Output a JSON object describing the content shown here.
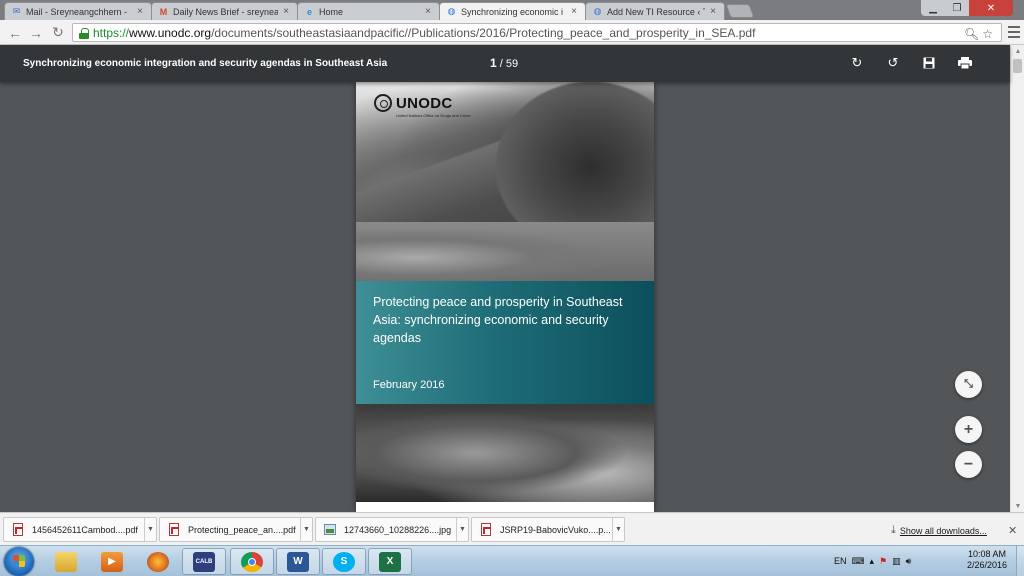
{
  "browser": {
    "tabs": [
      {
        "label": "Mail - Sreyneangchhern -",
        "icon": "mail-icon",
        "color": "#3a78c8"
      },
      {
        "label": "Daily News Brief - sreynea",
        "icon": "gmail-icon",
        "color": "#d44638"
      },
      {
        "label": "Home",
        "icon": "ie-icon",
        "color": "#2a8ee0"
      },
      {
        "label": "Synchronizing economic i",
        "icon": "globe-icon",
        "color": "#3a7bd5",
        "active": true
      },
      {
        "label": "Add New TI Resource ‹ TI",
        "icon": "globe-icon",
        "color": "#3a7bd5"
      }
    ],
    "url_scheme": "https://",
    "url_host": "www.unodc.org",
    "url_path": "/documents/southeastasiaandpacific//Publications/2016/Protecting_peace_and_prosperity_in_SEA.pdf"
  },
  "pdf_viewer": {
    "title": "Synchronizing economic integration and security agendas in Southeast Asia",
    "current_page": "1",
    "page_separator": "/",
    "total_pages": "59"
  },
  "document": {
    "org": "UNODC",
    "org_full": "United Nations Office on Drugs and Crime",
    "cover_title": "Protecting peace and prosperity in Southeast Asia: synchronizing economic and security agendas",
    "cover_date": "February 2016",
    "accent_color": "#1e6d78"
  },
  "downloads": {
    "items": [
      {
        "name": "1456452611Cambod....pdf",
        "type": "pdf"
      },
      {
        "name": "Protecting_peace_an....pdf",
        "type": "pdf"
      },
      {
        "name": "12743660_10288226....jpg",
        "type": "image"
      },
      {
        "name": "JSRP19-BabovicVuko....p...",
        "type": "pdf"
      }
    ],
    "show_all_label": "Show all downloads..."
  },
  "taskbar": {
    "apps": [
      "libraries",
      "media-player",
      "firefox",
      "calb",
      "chrome",
      "word",
      "skype",
      "excel"
    ],
    "calb_label": "CALB",
    "word_label": "W",
    "excel_label": "X",
    "skype_label": "S",
    "language": "EN",
    "time": "10:08 AM",
    "date": "2/26/2016"
  }
}
